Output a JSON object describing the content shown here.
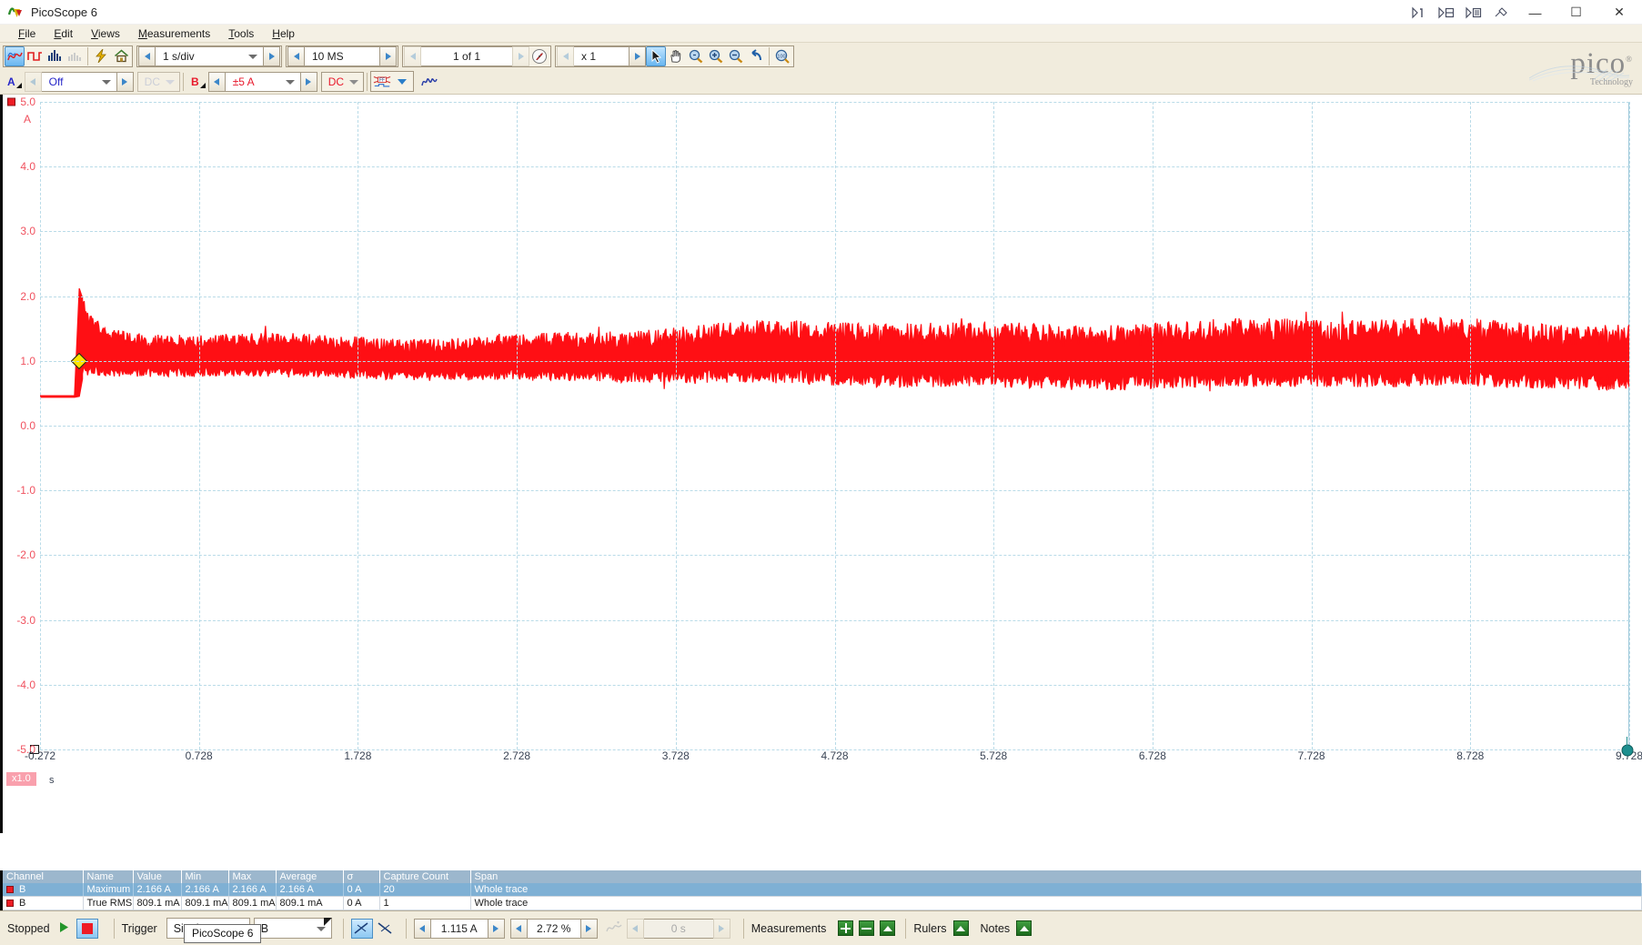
{
  "window": {
    "title": "PicoScope 6",
    "logo_icon": "picoscope-app-icon",
    "titlebar_icons": [
      "play-1-icon",
      "play-2-icon",
      "play-3-icon",
      "tools-icon"
    ],
    "minimize_label": "—",
    "maximize_label": "☐",
    "close_label": "✕"
  },
  "menu": {
    "items": [
      {
        "label": "File",
        "mnemonic": "F"
      },
      {
        "label": "Edit",
        "mnemonic": "E"
      },
      {
        "label": "Views",
        "mnemonic": "V"
      },
      {
        "label": "Measurements",
        "mnemonic": "M"
      },
      {
        "label": "Tools",
        "mnemonic": "T"
      },
      {
        "label": "Help",
        "mnemonic": "H"
      }
    ]
  },
  "toolbar": {
    "view_buttons": [
      {
        "name": "scope-view-button",
        "label": "Scope view",
        "selected": true
      },
      {
        "name": "persistence-view-button",
        "label": "Persistence mode",
        "selected": false
      },
      {
        "name": "spectrum-view-button",
        "label": "Spectrum view",
        "selected": false
      },
      {
        "name": "spectrum-mode-button",
        "label": "Spectrum mode",
        "selected": false,
        "disabled": true
      }
    ],
    "quick_buttons": [
      {
        "name": "autosetup-button",
        "label": "Auto setup"
      },
      {
        "name": "home-button",
        "label": "Home / Startup settings"
      }
    ],
    "timebase": {
      "label": "Collection time",
      "value": "1 s/div"
    },
    "samples": {
      "label": "Number of samples",
      "value": "10 MS"
    },
    "buffer": {
      "label": "Buffer navigation",
      "value": "1 of 1"
    },
    "buffer_nav_icon": "buffer-navigator-icon",
    "zoom_factor": {
      "label": "Zoom factor",
      "value": "x 1"
    },
    "tools": [
      {
        "name": "normal-select-tool",
        "label": "Normal selection",
        "icon": "cursor-arrow-icon",
        "selected": true
      },
      {
        "name": "hand-tool",
        "label": "Hand (pan)",
        "icon": "hand-icon",
        "selected": false
      },
      {
        "name": "zoom-select-tool",
        "label": "Marquee zoom",
        "icon": "magnifier-select-icon",
        "selected": false
      },
      {
        "name": "zoom-in-tool",
        "label": "Zoom in",
        "icon": "magnifier-plus-icon",
        "selected": false
      },
      {
        "name": "zoom-out-tool",
        "label": "Zoom out",
        "icon": "magnifier-minus-icon",
        "selected": false
      },
      {
        "name": "undo-zoom-tool",
        "label": "Undo zoom",
        "icon": "undo-arrow-icon",
        "selected": false
      },
      {
        "name": "zoom-100-tool",
        "label": "Zoom 100%",
        "icon": "magnifier-100-icon",
        "selected": false
      }
    ]
  },
  "channels": {
    "a": {
      "label": "A",
      "range": "Off",
      "coupling": "DC",
      "coupling_disabled": true,
      "color": "#2727c8"
    },
    "b": {
      "label": "B",
      "range": "±5 A",
      "coupling": "DC",
      "coupling_disabled": false,
      "color": "#e8182b"
    },
    "extras": [
      {
        "name": "resolution-enhancement-button",
        "label": "FFT / Advanced options",
        "icon": "fft-filter-icon"
      },
      {
        "name": "math-channel-button",
        "label": "Maths channels",
        "icon": "waveform-icon"
      }
    ]
  },
  "brand": {
    "word": "pico",
    "registered": "®",
    "tagline": "Technology"
  },
  "chart_data": {
    "type": "line",
    "title": "",
    "xlabel": "s",
    "ylabel": "A",
    "series_name": "B",
    "series_color": "#ff0f14",
    "xlim": [
      -0.272,
      9.728
    ],
    "ylim": [
      -5.0,
      5.0
    ],
    "grid": true,
    "y_ticks": [
      5.0,
      4.0,
      3.0,
      2.0,
      1.0,
      0.0,
      -1.0,
      -2.0,
      -3.0,
      -4.0,
      -5.0
    ],
    "y_tick_labels": [
      "5.0",
      "4.0",
      "3.0",
      "2.0",
      "1.0",
      "0.0",
      "-1.0",
      "-2.0",
      "-3.0",
      "-4.0",
      "-5.0"
    ],
    "x_ticks": [
      -0.272,
      0.728,
      1.728,
      2.728,
      3.728,
      4.728,
      5.728,
      6.728,
      7.728,
      8.728,
      9.728
    ],
    "x_tick_labels": [
      "-0.272",
      "0.728",
      "1.728",
      "2.728",
      "3.728",
      "4.728",
      "5.728",
      "6.728",
      "7.728",
      "8.728",
      "9.728"
    ],
    "x_zoom_badge": "x1.0",
    "x_unit": "s",
    "trigger_marker": {
      "x": -0.028,
      "y": 1.0,
      "icon": "trigger-diamond-marker"
    },
    "notes": "Channel B current trace: flat idle ~0.45 A until t=-0.05 s, 2.1 A turn-on spike, then dense noisy band averaging ~1.0 A with peaks to ~1.6 A and troughs to ~0.6 A for the remainder of the 10 s capture.",
    "baseline_level": 0.45,
    "spike_peak": 2.12,
    "band_mean": 1.0,
    "band_peak": 1.62,
    "band_trough": 0.58
  },
  "measurements": {
    "columns": [
      "Channel",
      "Name",
      "Value",
      "Min",
      "Max",
      "Average",
      "σ",
      "Capture Count",
      "Span"
    ],
    "rows": [
      {
        "selected": true,
        "cells": [
          "B",
          "Maximum",
          "2.166 A",
          "2.166 A",
          "2.166 A",
          "2.166 A",
          "0 A",
          "20",
          "Whole trace"
        ]
      },
      {
        "selected": false,
        "cells": [
          "B",
          "True RMS",
          "809.1 mA",
          "809.1 mA",
          "809.1 mA",
          "809.1 mA",
          "0 A",
          "1",
          "Whole trace"
        ]
      }
    ]
  },
  "status": {
    "state": "Stopped",
    "start_icon": "play-triangle-icon",
    "stop_icon": "stop-square-icon",
    "trigger_label": "Trigger",
    "trigger_mode": "Single",
    "trigger_source": "B",
    "edge_rising_icon": "trigger-rising-edge-icon",
    "edge_falling_icon": "trigger-falling-edge-icon",
    "threshold": "1.115 A",
    "pretrigger": "2.72 %",
    "advanced_trigger_icon": "advanced-trigger-icon",
    "delay": "0 s",
    "measurements_label": "Measurements",
    "add_measurement_icon": "plus-icon",
    "remove_measurement_icon": "minus-icon",
    "edit_measurement_icon": "up-arrow-icon",
    "rulers_label": "Rulers",
    "rulers_icon": "up-arrow-icon",
    "notes_label": "Notes",
    "notes_icon": "up-arrow-icon",
    "tooltip": "PicoScope 6"
  }
}
